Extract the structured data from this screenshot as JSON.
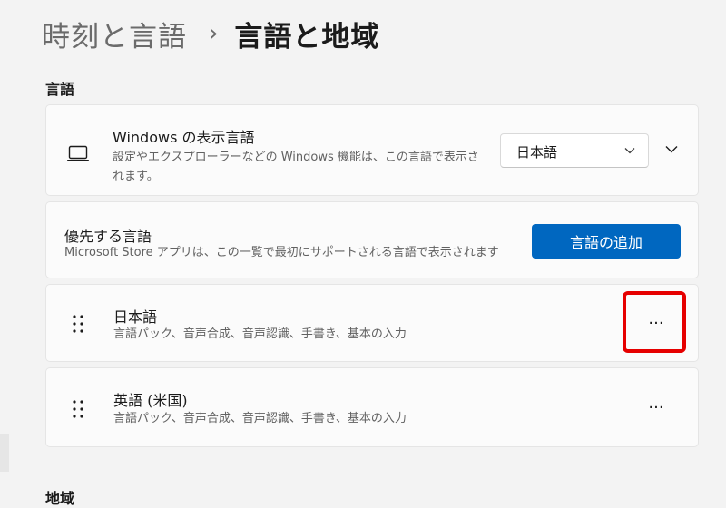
{
  "breadcrumb": {
    "parent": "時刻と言語",
    "separator": "›",
    "current": "言語と地域"
  },
  "language_section": {
    "title": "言語"
  },
  "display_language": {
    "title": "Windows の表示言語",
    "description": "設定やエクスプローラーなどの Windows 機能は、この言語で表示されます。",
    "selected": "日本語",
    "icon": "laptop-icon"
  },
  "preferred_languages": {
    "title": "優先する言語",
    "description": "Microsoft Store アプリは、この一覧で最初にサポートされる言語で表示されます",
    "add_button": "言語の追加",
    "items": [
      {
        "name": "日本語",
        "features": "言語パック、音声合成、音声認識、手書き、基本の入力",
        "more": "···",
        "highlighted": true
      },
      {
        "name": "英語 (米国)",
        "features": "言語パック、音声合成、音声認識、手書き、基本の入力",
        "more": "···",
        "highlighted": false
      }
    ]
  },
  "region_section": {
    "title": "地域"
  },
  "colors": {
    "accent": "#0067c0",
    "highlight": "#e60000",
    "background": "#f3f3f3",
    "card": "#fbfbfb"
  }
}
